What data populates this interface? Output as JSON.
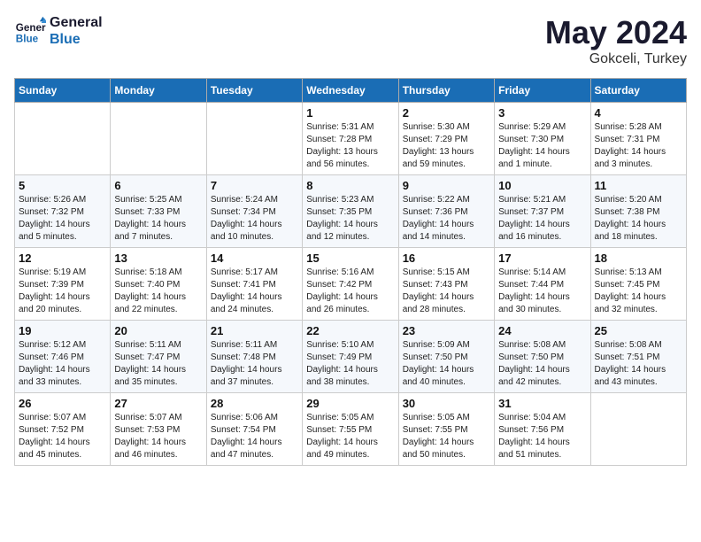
{
  "header": {
    "logo_general": "General",
    "logo_blue": "Blue",
    "month": "May 2024",
    "location": "Gokceli, Turkey"
  },
  "weekdays": [
    "Sunday",
    "Monday",
    "Tuesday",
    "Wednesday",
    "Thursday",
    "Friday",
    "Saturday"
  ],
  "weeks": [
    [
      {
        "day": "",
        "info": ""
      },
      {
        "day": "",
        "info": ""
      },
      {
        "day": "",
        "info": ""
      },
      {
        "day": "1",
        "sunrise": "Sunrise: 5:31 AM",
        "sunset": "Sunset: 7:28 PM",
        "daylight": "Daylight: 13 hours and 56 minutes."
      },
      {
        "day": "2",
        "sunrise": "Sunrise: 5:30 AM",
        "sunset": "Sunset: 7:29 PM",
        "daylight": "Daylight: 13 hours and 59 minutes."
      },
      {
        "day": "3",
        "sunrise": "Sunrise: 5:29 AM",
        "sunset": "Sunset: 7:30 PM",
        "daylight": "Daylight: 14 hours and 1 minute."
      },
      {
        "day": "4",
        "sunrise": "Sunrise: 5:28 AM",
        "sunset": "Sunset: 7:31 PM",
        "daylight": "Daylight: 14 hours and 3 minutes."
      }
    ],
    [
      {
        "day": "5",
        "sunrise": "Sunrise: 5:26 AM",
        "sunset": "Sunset: 7:32 PM",
        "daylight": "Daylight: 14 hours and 5 minutes."
      },
      {
        "day": "6",
        "sunrise": "Sunrise: 5:25 AM",
        "sunset": "Sunset: 7:33 PM",
        "daylight": "Daylight: 14 hours and 7 minutes."
      },
      {
        "day": "7",
        "sunrise": "Sunrise: 5:24 AM",
        "sunset": "Sunset: 7:34 PM",
        "daylight": "Daylight: 14 hours and 10 minutes."
      },
      {
        "day": "8",
        "sunrise": "Sunrise: 5:23 AM",
        "sunset": "Sunset: 7:35 PM",
        "daylight": "Daylight: 14 hours and 12 minutes."
      },
      {
        "day": "9",
        "sunrise": "Sunrise: 5:22 AM",
        "sunset": "Sunset: 7:36 PM",
        "daylight": "Daylight: 14 hours and 14 minutes."
      },
      {
        "day": "10",
        "sunrise": "Sunrise: 5:21 AM",
        "sunset": "Sunset: 7:37 PM",
        "daylight": "Daylight: 14 hours and 16 minutes."
      },
      {
        "day": "11",
        "sunrise": "Sunrise: 5:20 AM",
        "sunset": "Sunset: 7:38 PM",
        "daylight": "Daylight: 14 hours and 18 minutes."
      }
    ],
    [
      {
        "day": "12",
        "sunrise": "Sunrise: 5:19 AM",
        "sunset": "Sunset: 7:39 PM",
        "daylight": "Daylight: 14 hours and 20 minutes."
      },
      {
        "day": "13",
        "sunrise": "Sunrise: 5:18 AM",
        "sunset": "Sunset: 7:40 PM",
        "daylight": "Daylight: 14 hours and 22 minutes."
      },
      {
        "day": "14",
        "sunrise": "Sunrise: 5:17 AM",
        "sunset": "Sunset: 7:41 PM",
        "daylight": "Daylight: 14 hours and 24 minutes."
      },
      {
        "day": "15",
        "sunrise": "Sunrise: 5:16 AM",
        "sunset": "Sunset: 7:42 PM",
        "daylight": "Daylight: 14 hours and 26 minutes."
      },
      {
        "day": "16",
        "sunrise": "Sunrise: 5:15 AM",
        "sunset": "Sunset: 7:43 PM",
        "daylight": "Daylight: 14 hours and 28 minutes."
      },
      {
        "day": "17",
        "sunrise": "Sunrise: 5:14 AM",
        "sunset": "Sunset: 7:44 PM",
        "daylight": "Daylight: 14 hours and 30 minutes."
      },
      {
        "day": "18",
        "sunrise": "Sunrise: 5:13 AM",
        "sunset": "Sunset: 7:45 PM",
        "daylight": "Daylight: 14 hours and 32 minutes."
      }
    ],
    [
      {
        "day": "19",
        "sunrise": "Sunrise: 5:12 AM",
        "sunset": "Sunset: 7:46 PM",
        "daylight": "Daylight: 14 hours and 33 minutes."
      },
      {
        "day": "20",
        "sunrise": "Sunrise: 5:11 AM",
        "sunset": "Sunset: 7:47 PM",
        "daylight": "Daylight: 14 hours and 35 minutes."
      },
      {
        "day": "21",
        "sunrise": "Sunrise: 5:11 AM",
        "sunset": "Sunset: 7:48 PM",
        "daylight": "Daylight: 14 hours and 37 minutes."
      },
      {
        "day": "22",
        "sunrise": "Sunrise: 5:10 AM",
        "sunset": "Sunset: 7:49 PM",
        "daylight": "Daylight: 14 hours and 38 minutes."
      },
      {
        "day": "23",
        "sunrise": "Sunrise: 5:09 AM",
        "sunset": "Sunset: 7:50 PM",
        "daylight": "Daylight: 14 hours and 40 minutes."
      },
      {
        "day": "24",
        "sunrise": "Sunrise: 5:08 AM",
        "sunset": "Sunset: 7:50 PM",
        "daylight": "Daylight: 14 hours and 42 minutes."
      },
      {
        "day": "25",
        "sunrise": "Sunrise: 5:08 AM",
        "sunset": "Sunset: 7:51 PM",
        "daylight": "Daylight: 14 hours and 43 minutes."
      }
    ],
    [
      {
        "day": "26",
        "sunrise": "Sunrise: 5:07 AM",
        "sunset": "Sunset: 7:52 PM",
        "daylight": "Daylight: 14 hours and 45 minutes."
      },
      {
        "day": "27",
        "sunrise": "Sunrise: 5:07 AM",
        "sunset": "Sunset: 7:53 PM",
        "daylight": "Daylight: 14 hours and 46 minutes."
      },
      {
        "day": "28",
        "sunrise": "Sunrise: 5:06 AM",
        "sunset": "Sunset: 7:54 PM",
        "daylight": "Daylight: 14 hours and 47 minutes."
      },
      {
        "day": "29",
        "sunrise": "Sunrise: 5:05 AM",
        "sunset": "Sunset: 7:55 PM",
        "daylight": "Daylight: 14 hours and 49 minutes."
      },
      {
        "day": "30",
        "sunrise": "Sunrise: 5:05 AM",
        "sunset": "Sunset: 7:55 PM",
        "daylight": "Daylight: 14 hours and 50 minutes."
      },
      {
        "day": "31",
        "sunrise": "Sunrise: 5:04 AM",
        "sunset": "Sunset: 7:56 PM",
        "daylight": "Daylight: 14 hours and 51 minutes."
      },
      {
        "day": "",
        "info": ""
      }
    ]
  ]
}
